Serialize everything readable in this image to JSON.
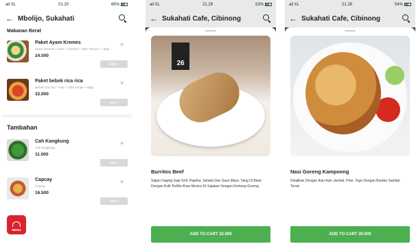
{
  "screen1": {
    "status": {
      "carrier": "all XL",
      "time": "01.20",
      "battery": "65%"
    },
    "appbar_title": "Mbolijo, Sukahati",
    "category": "Makanan Berat",
    "items": [
      {
        "name": "Paket Ayam Kremes",
        "desc": "Ayam Kremes + Nasi + Sambal + Tahu Tempe + Lalap",
        "price": "24.000",
        "add_label": "ADD"
      },
      {
        "name": "Paket bebek rica rica",
        "desc": "Bebek rica rica + nasi + tahu tempe + lalap",
        "price": "32.000",
        "add_label": "ADD"
      }
    ],
    "section2": "Tambahan",
    "items2": [
      {
        "name": "Cah Kangkung",
        "desc": "Cah kangkung",
        "price": "11.000",
        "add_label": "ADD"
      },
      {
        "name": "Capcay",
        "desc": "Capcay",
        "price": "16.500",
        "add_label": "ADD"
      }
    ],
    "fab_label": "MENU"
  },
  "screen2": {
    "status": {
      "carrier": "all XL",
      "time": "21.29",
      "battery": "53%"
    },
    "appbar_title": "Sukahati Cafe, Cibinong",
    "photo_sign": "26",
    "dish_name": "Burritos Beef",
    "dish_desc": "Sajian Daging Sapi Grill, Paprika, Selada Dan Saus Mayo, Yang Di Balut Dengan Kulit Tortilla Khas Mexico Di Sajakan Dengan Kentang Goreng",
    "cart_label": "ADD TO CART 32.000"
  },
  "screen3": {
    "status": {
      "carrier": "all XL",
      "time": "21.28",
      "battery": "54%"
    },
    "appbar_title": "Sukahati Cafe, Cibinong",
    "dish_name": "Nasi Goreng Kampoeng",
    "dish_desc": "Disajikan Dengan Ikan Asin Jambal, Pete, Toge Dengan Bumbu Sambel Terasi",
    "cart_label": "ADD TO CART 30.000"
  }
}
